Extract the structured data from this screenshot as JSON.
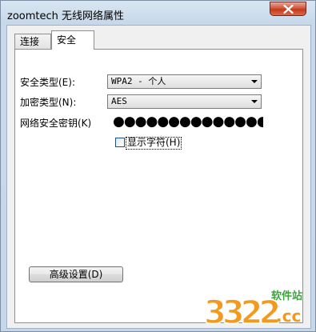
{
  "window": {
    "title": "zoomtech 无线网络属性"
  },
  "tabs": [
    {
      "label": "连接",
      "active": false
    },
    {
      "label": "安全",
      "active": true
    }
  ],
  "security": {
    "security_type_label": "安全类型(E):",
    "security_type_value": "WPA2 - 个人",
    "encryption_type_label": "加密类型(N):",
    "encryption_type_value": "AES",
    "key_label": "网络安全密钥(K)",
    "key_masked": "●●●●●●●●●●●●●●●",
    "show_chars_label": "显示字符(H)",
    "show_chars_checked": false,
    "advanced_button": "高级设置(D)"
  },
  "watermark": {
    "digits": "3322",
    "site": "软件站",
    "suffix": ".cc"
  },
  "colors": {
    "close_button": "#c43a1e",
    "title_bar": "#c7d8ea",
    "watermark_orange": "#f39a1e",
    "watermark_green": "#3aa63a"
  }
}
